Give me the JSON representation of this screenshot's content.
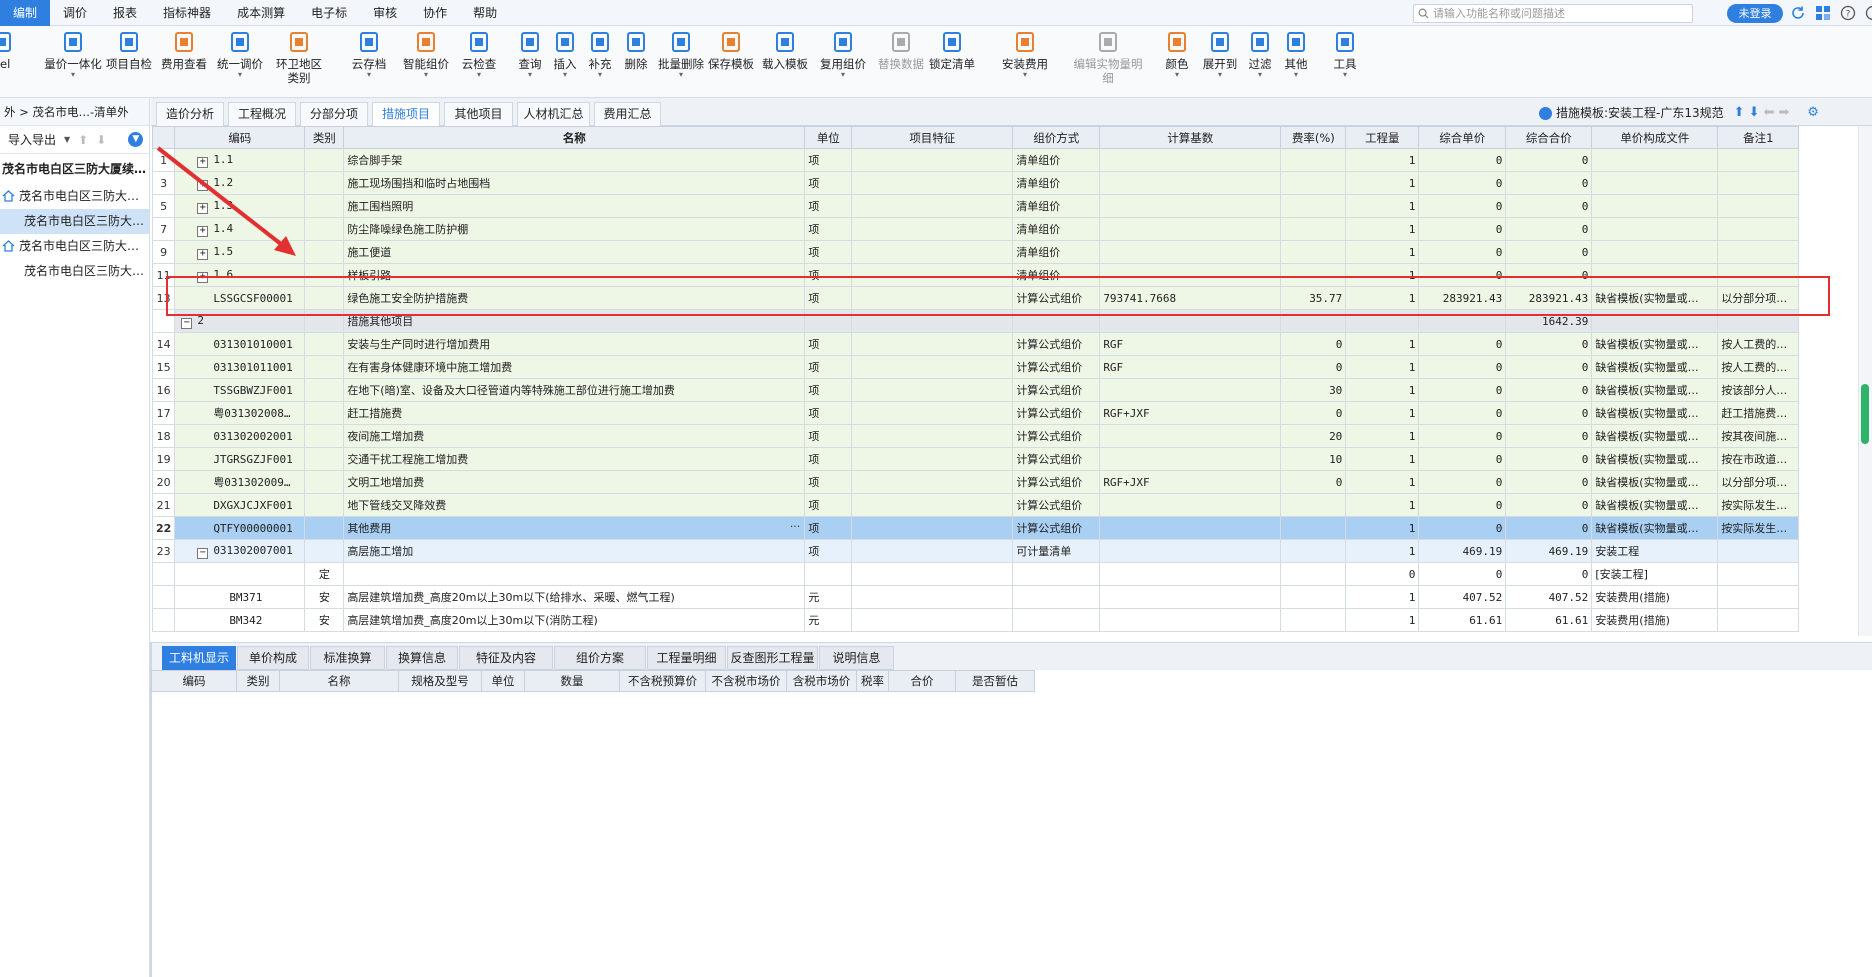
{
  "menubar": {
    "items": [
      "编制",
      "调价",
      "报表",
      "指标神器",
      "成本测算",
      "电子标",
      "审核",
      "协作",
      "帮助"
    ],
    "active_index": 0,
    "search_placeholder": "请输入功能名称或问题描述",
    "login_label": "未登录"
  },
  "toolbar": {
    "buttons": [
      {
        "label": "cel",
        "icon": "excel-icon"
      },
      {
        "label": "量价一体化",
        "icon": "price-integration-icon"
      },
      {
        "label": "项目自检",
        "icon": "project-check-icon"
      },
      {
        "label": "费用查看",
        "icon": "fee-view-icon"
      },
      {
        "label": "统一调价",
        "icon": "unified-pricing-icon"
      },
      {
        "label": "环卫地区类别",
        "icon": "sanitation-region-icon"
      },
      {
        "label": "云存档",
        "icon": "cloud-archive-icon"
      },
      {
        "label": "智能组价",
        "icon": "smart-pricing-icon"
      },
      {
        "label": "云检查",
        "icon": "cloud-check-icon"
      },
      {
        "label": "查询",
        "icon": "query-icon"
      },
      {
        "label": "插入",
        "icon": "insert-icon"
      },
      {
        "label": "补充",
        "icon": "supplement-icon"
      },
      {
        "label": "删除",
        "icon": "delete-icon"
      },
      {
        "label": "批量删除",
        "icon": "batch-delete-icon"
      },
      {
        "label": "保存模板",
        "icon": "save-template-icon"
      },
      {
        "label": "载入模板",
        "icon": "load-template-icon"
      },
      {
        "label": "复用组价",
        "icon": "reuse-pricing-icon"
      },
      {
        "label": "替换数据",
        "icon": "replace-data-icon"
      },
      {
        "label": "锁定清单",
        "icon": "lock-list-icon"
      },
      {
        "label": "安装费用",
        "icon": "install-fee-icon"
      },
      {
        "label": "编辑实物量明细",
        "icon": "edit-quantity-icon"
      },
      {
        "label": "颜色",
        "icon": "color-icon"
      },
      {
        "label": "展开到",
        "icon": "expand-to-icon"
      },
      {
        "label": "过滤",
        "icon": "filter-icon"
      },
      {
        "label": "其他",
        "icon": "other-icon"
      },
      {
        "label": "工具",
        "icon": "tools-icon"
      }
    ]
  },
  "left_panel": {
    "breadcrumb": "外 > 茂名市电…-清单外",
    "import_export_label": "导入导出",
    "tree": [
      {
        "label": "茂名市电白区三防大厦续…",
        "level": 0
      },
      {
        "label": "茂名市电白区三防大…",
        "level": 1,
        "home": true
      },
      {
        "label": "茂名市电白区三防大…",
        "level": 2,
        "selected": true
      },
      {
        "label": "茂名市电白区三防大…",
        "level": 1,
        "home": true
      },
      {
        "label": "茂名市电白区三防大…",
        "level": 2
      }
    ]
  },
  "tabs": {
    "items": [
      "造价分析",
      "工程概况",
      "分部分项",
      "措施项目",
      "其他项目",
      "人材机汇总",
      "费用汇总"
    ],
    "active_index": 3,
    "template_label": "措施模板:安装工程-广东13规范"
  },
  "grid": {
    "headers": [
      "",
      "编码",
      "类别",
      "名称",
      "单位",
      "项目特征",
      "组价方式",
      "计算基数",
      "费率(%)",
      "工程量",
      "综合单价",
      "综合合价",
      "单价构成文件",
      "备注1"
    ],
    "rows": [
      {
        "no": "1",
        "style": "green",
        "code": "1.1",
        "expander": "+",
        "indent": 1,
        "cat": "",
        "name": "综合脚手架",
        "unit": "项",
        "feature": "",
        "method": "清单组价",
        "base": "",
        "rate": "",
        "qty": "1",
        "unit_price": "0",
        "total": "0",
        "file": "",
        "note": ""
      },
      {
        "no": "3",
        "style": "green",
        "code": "1.2",
        "expander": "+",
        "indent": 1,
        "cat": "",
        "name": "施工现场围挡和临时占地围档",
        "unit": "项",
        "feature": "",
        "method": "清单组价",
        "base": "",
        "rate": "",
        "qty": "1",
        "unit_price": "0",
        "total": "0",
        "file": "",
        "note": ""
      },
      {
        "no": "5",
        "style": "green",
        "code": "1.3",
        "expander": "+",
        "indent": 1,
        "cat": "",
        "name": "施工围档照明",
        "unit": "项",
        "feature": "",
        "method": "清单组价",
        "base": "",
        "rate": "",
        "qty": "1",
        "unit_price": "0",
        "total": "0",
        "file": "",
        "note": ""
      },
      {
        "no": "7",
        "style": "green",
        "code": "1.4",
        "expander": "+",
        "indent": 1,
        "cat": "",
        "name": "防尘降噪绿色施工防护棚",
        "unit": "项",
        "feature": "",
        "method": "清单组价",
        "base": "",
        "rate": "",
        "qty": "1",
        "unit_price": "0",
        "total": "0",
        "file": "",
        "note": ""
      },
      {
        "no": "9",
        "style": "green",
        "code": "1.5",
        "expander": "+",
        "indent": 1,
        "cat": "",
        "name": "施工便道",
        "unit": "项",
        "feature": "",
        "method": "清单组价",
        "base": "",
        "rate": "",
        "qty": "1",
        "unit_price": "0",
        "total": "0",
        "file": "",
        "note": ""
      },
      {
        "no": "11",
        "style": "green",
        "code": "1.6",
        "expander": "+",
        "indent": 1,
        "cat": "",
        "name": "样板引路",
        "unit": "项",
        "feature": "",
        "method": "清单组价",
        "base": "",
        "rate": "",
        "qty": "1",
        "unit_price": "0",
        "total": "0",
        "file": "",
        "note": ""
      },
      {
        "no": "13",
        "style": "green",
        "code": "LSSGCSF00001",
        "expander": "",
        "indent": 1,
        "cat": "",
        "name": "绿色施工安全防护措施费",
        "unit": "项",
        "feature": "",
        "method": "计算公式组价",
        "base": "793741.7668",
        "rate": "35.77",
        "qty": "1",
        "unit_price": "283921.43",
        "total": "283921.43",
        "file": "缺省模板(实物量或…",
        "note": "以分部分项…"
      },
      {
        "no": "",
        "style": "gray",
        "code": "2",
        "expander": "−",
        "indent": 0,
        "cat": "",
        "name": "措施其他项目",
        "unit": "",
        "feature": "",
        "method": "",
        "base": "",
        "rate": "",
        "qty": "",
        "unit_price": "",
        "total": "1642.39",
        "file": "",
        "note": ""
      },
      {
        "no": "14",
        "style": "green",
        "code": "031301010001",
        "expander": "",
        "indent": 1,
        "cat": "",
        "name": "安装与生产同时进行增加费用",
        "unit": "项",
        "feature": "",
        "method": "计算公式组价",
        "base": "RGF",
        "rate": "0",
        "qty": "1",
        "unit_price": "0",
        "total": "0",
        "file": "缺省模板(实物量或…",
        "note": "按人工费的…"
      },
      {
        "no": "15",
        "style": "green",
        "code": "031301011001",
        "expander": "",
        "indent": 1,
        "cat": "",
        "name": "在有害身体健康环境中施工增加费",
        "unit": "项",
        "feature": "",
        "method": "计算公式组价",
        "base": "RGF",
        "rate": "0",
        "qty": "1",
        "unit_price": "0",
        "total": "0",
        "file": "缺省模板(实物量或…",
        "note": "按人工费的…"
      },
      {
        "no": "16",
        "style": "green",
        "code": "TSSGBWZJF001",
        "expander": "",
        "indent": 1,
        "cat": "",
        "name": "在地下(暗)室、设备及大口径管道内等特殊施工部位进行施工增加费",
        "unit": "项",
        "feature": "",
        "method": "计算公式组价",
        "base": "",
        "rate": "30",
        "qty": "1",
        "unit_price": "0",
        "total": "0",
        "file": "缺省模板(实物量或…",
        "note": "按该部分人…"
      },
      {
        "no": "17",
        "style": "green",
        "code": "粤031302008…",
        "expander": "",
        "indent": 1,
        "cat": "",
        "name": "赶工措施费",
        "unit": "项",
        "feature": "",
        "method": "计算公式组价",
        "base": "RGF+JXF",
        "rate": "0",
        "qty": "1",
        "unit_price": "0",
        "total": "0",
        "file": "缺省模板(实物量或…",
        "note": "赶工措施费…"
      },
      {
        "no": "18",
        "style": "green",
        "code": "031302002001",
        "expander": "",
        "indent": 1,
        "cat": "",
        "name": "夜间施工增加费",
        "unit": "项",
        "feature": "",
        "method": "计算公式组价",
        "base": "",
        "rate": "20",
        "qty": "1",
        "unit_price": "0",
        "total": "0",
        "file": "缺省模板(实物量或…",
        "note": "按其夜间施…"
      },
      {
        "no": "19",
        "style": "green",
        "code": "JTGRSGZJF001",
        "expander": "",
        "indent": 1,
        "cat": "",
        "name": "交通干扰工程施工增加费",
        "unit": "项",
        "feature": "",
        "method": "计算公式组价",
        "base": "",
        "rate": "10",
        "qty": "1",
        "unit_price": "0",
        "total": "0",
        "file": "缺省模板(实物量或…",
        "note": "按在市政道…"
      },
      {
        "no": "20",
        "style": "green",
        "code": "粤031302009…",
        "expander": "",
        "indent": 1,
        "cat": "",
        "name": "文明工地增加费",
        "unit": "项",
        "feature": "",
        "method": "计算公式组价",
        "base": "RGF+JXF",
        "rate": "0",
        "qty": "1",
        "unit_price": "0",
        "total": "0",
        "file": "缺省模板(实物量或…",
        "note": "以分部分项…"
      },
      {
        "no": "21",
        "style": "green",
        "code": "DXGXJCJXF001",
        "expander": "",
        "indent": 1,
        "cat": "",
        "name": "地下管线交叉降效费",
        "unit": "项",
        "feature": "",
        "method": "计算公式组价",
        "base": "",
        "rate": "",
        "qty": "1",
        "unit_price": "0",
        "total": "0",
        "file": "缺省模板(实物量或…",
        "note": "按实际发生…"
      },
      {
        "no": "22",
        "style": "blue",
        "code": "QTFY00000001",
        "expander": "",
        "indent": 1,
        "cat": "",
        "name": "其他费用",
        "unit": "项",
        "feature": "",
        "method": "计算公式组价",
        "base": "",
        "rate": "",
        "qty": "1",
        "unit_price": "0",
        "total": "0",
        "file": "缺省模板(实物量或…",
        "note": "按实际发生…"
      },
      {
        "no": "23",
        "style": "lightblue",
        "code": "031302007001",
        "expander": "−",
        "indent": 1,
        "cat": "",
        "name": "高层施工增加",
        "unit": "项",
        "feature": "",
        "method": "可计量清单",
        "base": "",
        "rate": "",
        "qty": "1",
        "unit_price": "469.19",
        "total": "469.19",
        "file": "安装工程",
        "note": ""
      },
      {
        "no": "",
        "style": "white",
        "code": "",
        "expander": "",
        "indent": 2,
        "cat": "定",
        "name": "",
        "unit": "",
        "feature": "",
        "method": "",
        "base": "",
        "rate": "",
        "qty": "0",
        "unit_price": "0",
        "total": "0",
        "file": "[安装工程]",
        "note": ""
      },
      {
        "no": "",
        "style": "white",
        "code": "BM371",
        "expander": "",
        "indent": 2,
        "cat": "安",
        "name": "高层建筑增加费_高度20m以上30m以下(给排水、采暖、燃气工程)",
        "unit": "元",
        "feature": "",
        "method": "",
        "base": "",
        "rate": "",
        "qty": "1",
        "unit_price": "407.52",
        "total": "407.52",
        "file": "安装费用(措施)",
        "note": ""
      },
      {
        "no": "",
        "style": "white",
        "code": "BM342",
        "expander": "",
        "indent": 2,
        "cat": "安",
        "name": "高层建筑增加费_高度20m以上30m以下(消防工程)",
        "unit": "元",
        "feature": "",
        "method": "",
        "base": "",
        "rate": "",
        "qty": "1",
        "unit_price": "61.61",
        "total": "61.61",
        "file": "安装费用(措施)",
        "note": ""
      }
    ]
  },
  "bottom": {
    "tabs": [
      "工料机显示",
      "单价构成",
      "标准换算",
      "换算信息",
      "特征及内容",
      "组价方案",
      "工程量明细",
      "反查图形工程量",
      "说明信息"
    ],
    "active_index": 0,
    "headers": [
      "编码",
      "类别",
      "名称",
      "规格及型号",
      "单位",
      "数量",
      "不含税预算价",
      "不含税市场价",
      "含税市场价",
      "税率",
      "合价",
      "是否暂估"
    ]
  },
  "colors": {
    "accent": "#2f7fe0",
    "row_green": "#eef6e6",
    "row_selected": "#a9cff3",
    "highlight_red": "#e23030"
  }
}
